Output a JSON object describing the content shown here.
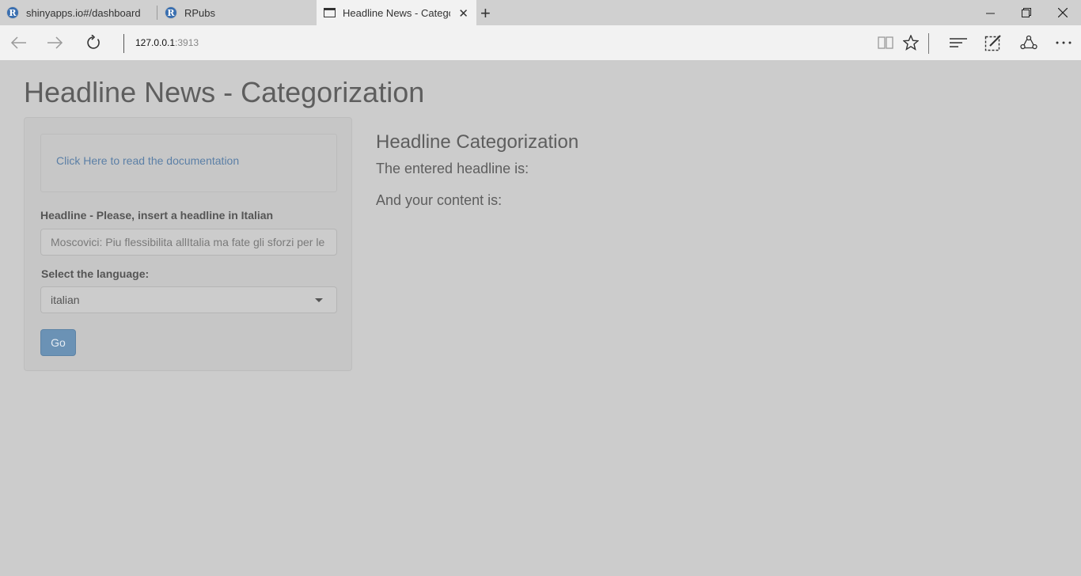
{
  "browser": {
    "tabs": [
      {
        "label": "shinyapps.io#/dashboard",
        "icon": "r-logo-icon"
      },
      {
        "label": "RPubs",
        "icon": "r-logo-icon"
      },
      {
        "label": "Headline News - Categorization",
        "icon": "page-icon",
        "active": true
      }
    ],
    "url_host": "127.0.0.1",
    "url_port": ":3913"
  },
  "page": {
    "title": "Headline News - Categorization",
    "sidebar": {
      "doc_link": "Click Here to read the documentation",
      "headline_label": "Headline - Please, insert a headline in Italian",
      "headline_value": "Moscovici: Piu flessibilita allItalia ma fate gli sforzi per le",
      "language_label": "Select the language:",
      "language_value": "italian",
      "go_label": "Go"
    },
    "main": {
      "heading": "Headline Categorization",
      "line1": "The entered headline is:",
      "line2": "And your content is:"
    }
  }
}
